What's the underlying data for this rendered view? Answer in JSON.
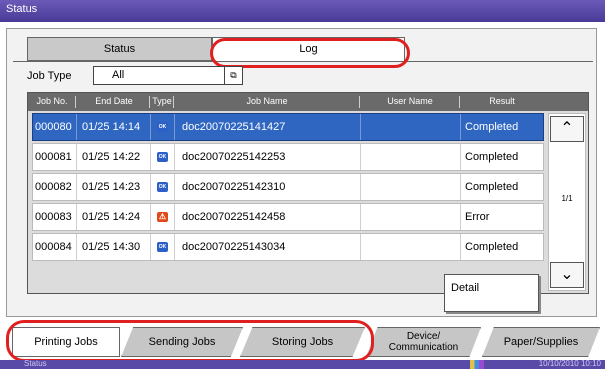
{
  "window": {
    "title": "Status"
  },
  "tabs": {
    "status": "Status",
    "log": "Log"
  },
  "filter": {
    "label": "Job Type",
    "value": "All"
  },
  "table": {
    "headers": [
      "Job No.",
      "End Date",
      "Type",
      "Job Name",
      "User Name",
      "Result"
    ],
    "rows": [
      {
        "no": "000080",
        "date": "01/25 14:14",
        "type": "ok",
        "name": "doc20070225141427",
        "user": "",
        "result": "Completed",
        "selected": true
      },
      {
        "no": "000081",
        "date": "01/25 14:22",
        "type": "ok",
        "name": "doc20070225142253",
        "user": "",
        "result": "Completed"
      },
      {
        "no": "000082",
        "date": "01/25 14:23",
        "type": "ok",
        "name": "doc20070225142310",
        "user": "",
        "result": "Completed"
      },
      {
        "no": "000083",
        "date": "01/25 14:24",
        "type": "error",
        "name": "doc20070225142458",
        "user": "",
        "result": "Error"
      },
      {
        "no": "000084",
        "date": "01/25 14:30",
        "type": "ok",
        "name": "doc20070225143034",
        "user": "",
        "result": "Completed"
      }
    ],
    "page_indicator": "1/1"
  },
  "buttons": {
    "detail": "Detail"
  },
  "bottom_tabs": {
    "printing": "Printing Jobs",
    "sending": "Sending Jobs",
    "storing": "Storing Jobs",
    "device_line1": "Device/",
    "device_line2": "Communication",
    "paper": "Paper/Supplies"
  },
  "statusbar": {
    "left": "Status",
    "clock": "10/10/2010 10:10"
  },
  "colors": {
    "accent": "#4a3a98",
    "selected_row": "#2e66c2",
    "highlight_ring": "#e02020"
  }
}
